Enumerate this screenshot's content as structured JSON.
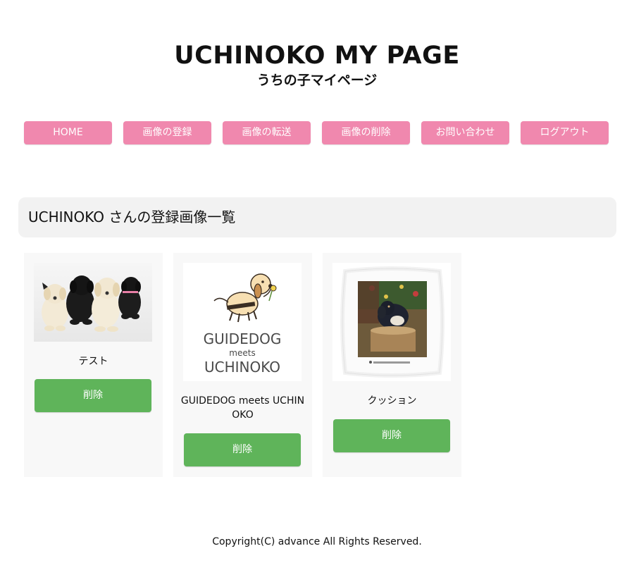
{
  "header": {
    "title": "UCHINOKO MY PAGE",
    "subtitle": "うちの子マイページ"
  },
  "nav": [
    {
      "label": "HOME"
    },
    {
      "label": "画像の登録"
    },
    {
      "label": "画像の転送"
    },
    {
      "label": "画像の削除"
    },
    {
      "label": "お問い合わせ"
    },
    {
      "label": "ログアウト"
    }
  ],
  "section": {
    "title": "UCHINOKO さんの登録画像一覧"
  },
  "cards": [
    {
      "label": "テスト",
      "delete_label": "削除",
      "image": "puppies-photo"
    },
    {
      "label": "GUIDEDOG meets UCHINOKO",
      "delete_label": "削除",
      "image": "guidedog-logo",
      "logo": {
        "line1": "GUIDEDOG",
        "line2": "meets",
        "line3": "UCHINOKO"
      }
    },
    {
      "label": "クッション",
      "delete_label": "削除",
      "image": "dog-cushion-photo"
    }
  ],
  "footer": {
    "copyright": "Copyright(C) advance All Rights Reserved."
  },
  "colors": {
    "nav_button": "#f088ae",
    "delete_button": "#5fb45a",
    "section_bg": "#f2f2f2",
    "card_bg": "#f8f8f8"
  }
}
